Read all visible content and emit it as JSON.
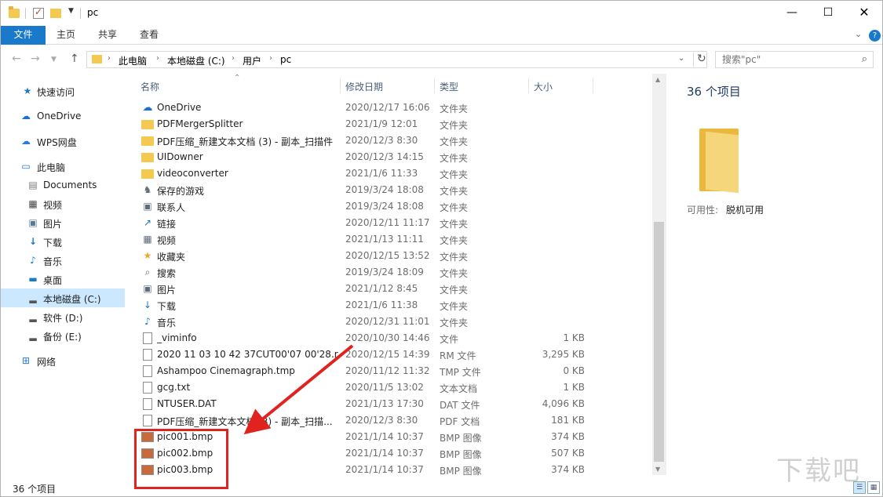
{
  "window": {
    "title": "pc",
    "controls": {
      "minimize": "—",
      "maximize": "☐",
      "close": "✕"
    }
  },
  "ribbon": {
    "tabs": [
      "文件",
      "主页",
      "共享",
      "查看"
    ]
  },
  "address": {
    "crumbs": [
      "此电脑",
      "本地磁盘 (C:)",
      "用户",
      "pc"
    ],
    "search_placeholder": "搜索\"pc\""
  },
  "sidebar": {
    "items": [
      {
        "label": "快速访问",
        "icon": "star-icon"
      },
      {
        "label": "OneDrive",
        "icon": "cloud-icon"
      },
      {
        "label": "WPS网盘",
        "icon": "cloud-icon"
      },
      {
        "label": "此电脑",
        "icon": "computer-icon"
      },
      {
        "label": "Documents",
        "icon": "document-icon"
      },
      {
        "label": "视频",
        "icon": "video-icon"
      },
      {
        "label": "图片",
        "icon": "picture-icon"
      },
      {
        "label": "下载",
        "icon": "download-icon"
      },
      {
        "label": "音乐",
        "icon": "music-icon"
      },
      {
        "label": "桌面",
        "icon": "desktop-icon"
      },
      {
        "label": "本地磁盘 (C:)",
        "icon": "drive-icon",
        "selected": true
      },
      {
        "label": "软件 (D:)",
        "icon": "drive-icon"
      },
      {
        "label": "备份 (E:)",
        "icon": "drive-icon"
      },
      {
        "label": "网络",
        "icon": "network-icon"
      }
    ]
  },
  "columns": {
    "name": "名称",
    "date": "修改日期",
    "type": "类型",
    "size": "大小"
  },
  "files": [
    {
      "name": "OneDrive",
      "date": "2020/12/17 16:06",
      "type": "文件夹",
      "size": "",
      "icon": "cloud-icon"
    },
    {
      "name": "PDFMergerSplitter",
      "date": "2021/1/9 12:01",
      "type": "文件夹",
      "size": "",
      "icon": "folder-icon"
    },
    {
      "name": "PDF压缩_新建文本文档 (3) - 副本_扫描件",
      "date": "2020/12/3 8:30",
      "type": "文件夹",
      "size": "",
      "icon": "folder-icon"
    },
    {
      "name": "UIDowner",
      "date": "2020/12/3 14:15",
      "type": "文件夹",
      "size": "",
      "icon": "folder-icon"
    },
    {
      "name": "videoconverter",
      "date": "2021/1/6 11:33",
      "type": "文件夹",
      "size": "",
      "icon": "folder-icon"
    },
    {
      "name": "保存的游戏",
      "date": "2019/3/24 18:08",
      "type": "文件夹",
      "size": "",
      "icon": "game-icon"
    },
    {
      "name": "联系人",
      "date": "2019/3/24 18:08",
      "type": "文件夹",
      "size": "",
      "icon": "contacts-icon"
    },
    {
      "name": "链接",
      "date": "2020/12/11 11:17",
      "type": "文件夹",
      "size": "",
      "icon": "link-icon"
    },
    {
      "name": "视频",
      "date": "2021/1/13 11:11",
      "type": "文件夹",
      "size": "",
      "icon": "video-icon"
    },
    {
      "name": "收藏夹",
      "date": "2020/12/15 13:52",
      "type": "文件夹",
      "size": "",
      "icon": "star-icon"
    },
    {
      "name": "搜索",
      "date": "2019/3/24 18:09",
      "type": "文件夹",
      "size": "",
      "icon": "search-icon"
    },
    {
      "name": "图片",
      "date": "2021/1/12 8:45",
      "type": "文件夹",
      "size": "",
      "icon": "picture-icon"
    },
    {
      "name": "下载",
      "date": "2021/1/6 11:38",
      "type": "文件夹",
      "size": "",
      "icon": "download-icon"
    },
    {
      "name": "音乐",
      "date": "2020/12/31 11:01",
      "type": "文件夹",
      "size": "",
      "icon": "music-icon"
    },
    {
      "name": "_viminfo",
      "date": "2020/10/30 14:46",
      "type": "文件",
      "size": "1 KB",
      "icon": "file-icon"
    },
    {
      "name": "2020 11 03 10 42 37CUT00'07 00'28.r...",
      "date": "2020/12/15 14:39",
      "type": "RM 文件",
      "size": "3,295 KB",
      "icon": "file-icon"
    },
    {
      "name": "Ashampoo Cinemagraph.tmp",
      "date": "2020/11/12 11:32",
      "type": "TMP 文件",
      "size": "0 KB",
      "icon": "file-icon"
    },
    {
      "name": "gcg.txt",
      "date": "2020/11/5 13:02",
      "type": "文本文档",
      "size": "1 KB",
      "icon": "text-file-icon"
    },
    {
      "name": "NTUSER.DAT",
      "date": "2021/1/13 17:30",
      "type": "DAT 文件",
      "size": "4,096 KB",
      "icon": "file-icon"
    },
    {
      "name": "PDF压缩_新建文本文档 (3) - 副本_扫描...",
      "date": "2020/12/3 8:30",
      "type": "PDF 文档",
      "size": "181 KB",
      "icon": "pdf-icon"
    },
    {
      "name": "pic001.bmp",
      "date": "2021/1/14 10:37",
      "type": "BMP 图像",
      "size": "374 KB",
      "icon": "bmp-icon"
    },
    {
      "name": "pic002.bmp",
      "date": "2021/1/14 10:37",
      "type": "BMP 图像",
      "size": "507 KB",
      "icon": "bmp-icon"
    },
    {
      "name": "pic003.bmp",
      "date": "2021/1/14 10:37",
      "type": "BMP 图像",
      "size": "374 KB",
      "icon": "bmp-icon"
    }
  ],
  "details": {
    "count": "36 个项目",
    "availability_label": "可用性:",
    "availability_value": "脱机可用"
  },
  "status": {
    "text": "36 个项目"
  },
  "colors": {
    "accent": "#1979ca",
    "selection": "#cce8ff",
    "annotation": "#e0231f"
  },
  "watermark": "下载吧"
}
